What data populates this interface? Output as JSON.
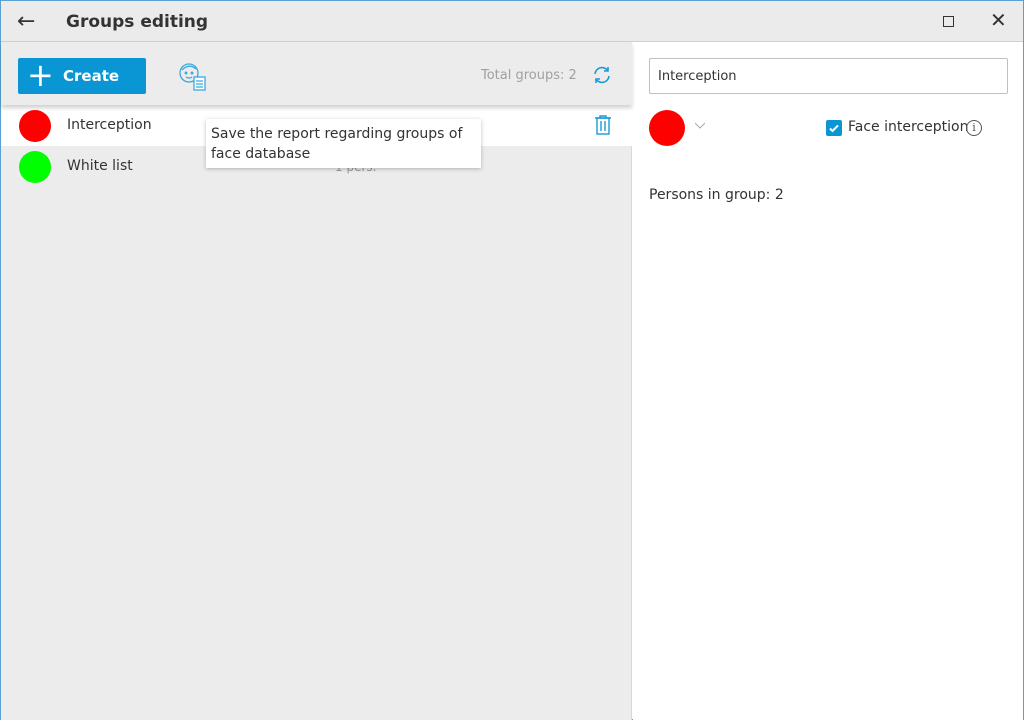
{
  "window": {
    "title": "Groups editing"
  },
  "toolbar": {
    "create_label": "Create",
    "total_groups": "Total groups: 2"
  },
  "tooltip": "Save the report regarding groups of face database",
  "groups": [
    {
      "name": "Interception",
      "color": "#ff0000",
      "count": ""
    },
    {
      "name": "White list",
      "color": "#00ff00",
      "count": "1 pers."
    }
  ],
  "details": {
    "name_value": "Interception",
    "color": "#ff0000",
    "face_interception_label": "Face interception",
    "face_interception_checked": true,
    "persons_in_group": "Persons in group: 2"
  },
  "colors": {
    "accent": "#0a96d4"
  }
}
